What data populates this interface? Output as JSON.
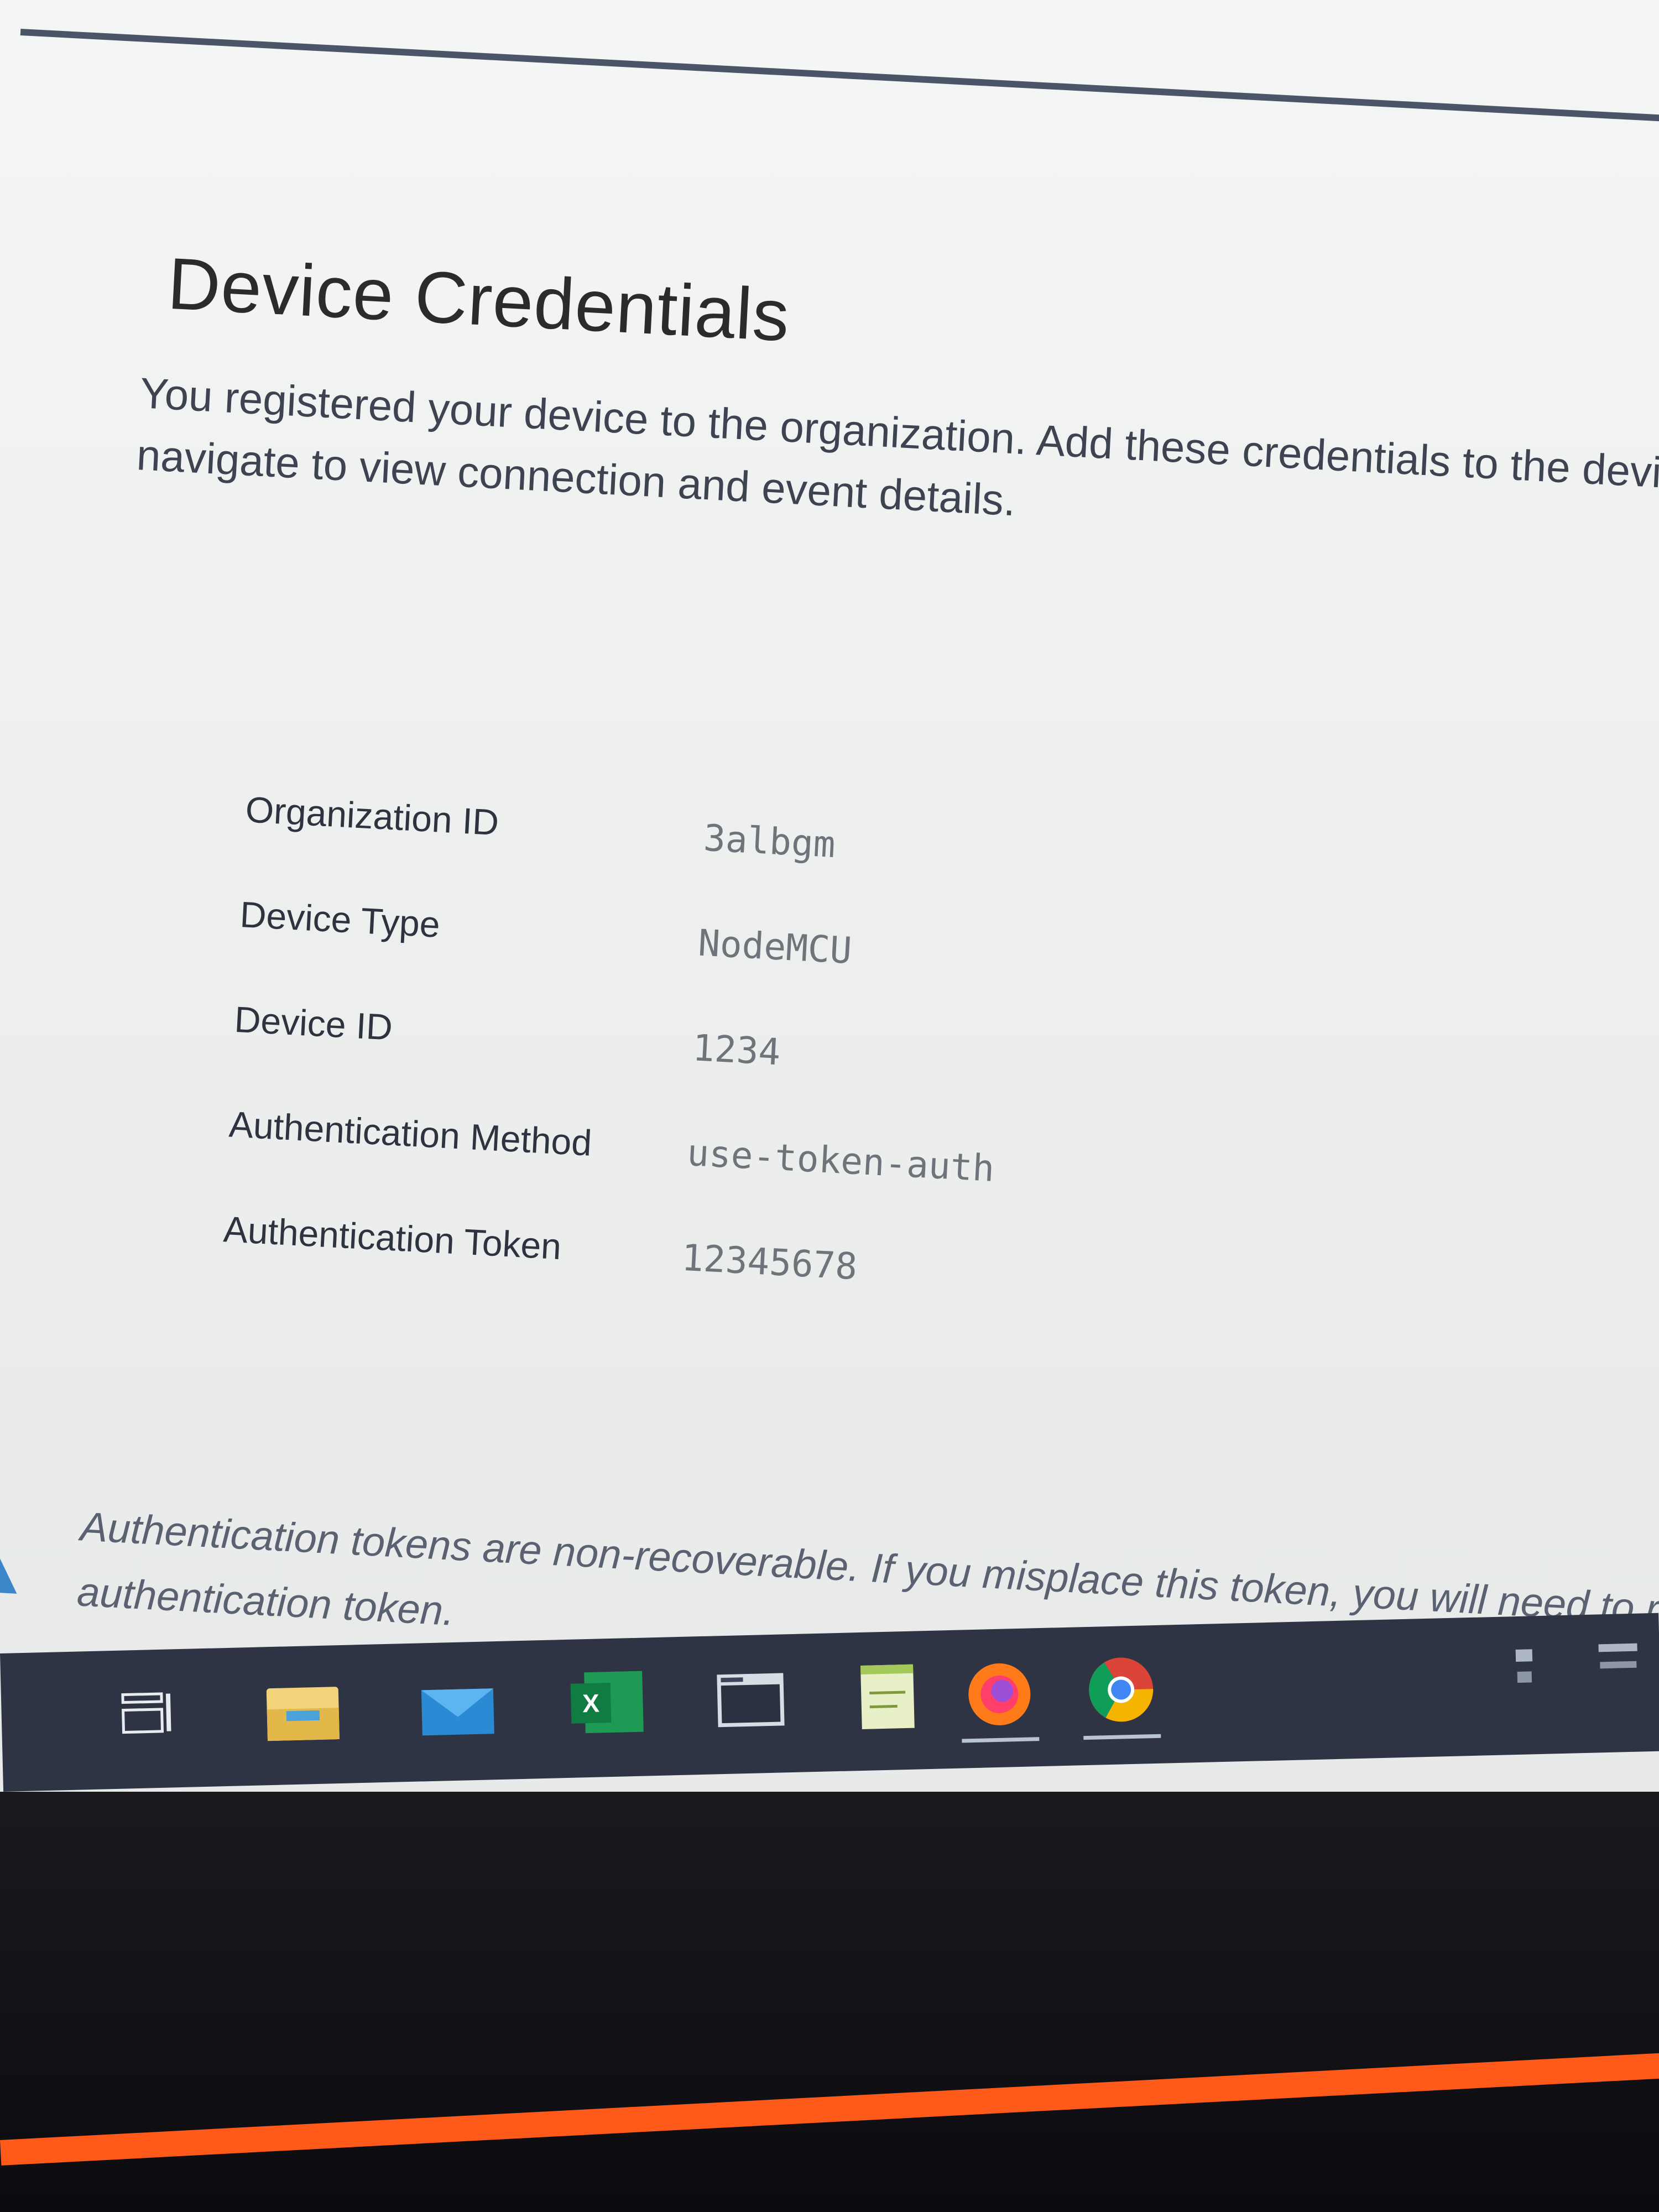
{
  "page": {
    "title": "Device Credentials",
    "description": "You registered your device to the organization. Add these credentials to the device can navigate to view connection and event details."
  },
  "credentials": [
    {
      "label": "Organization ID",
      "value": "3albgm"
    },
    {
      "label": "Device Type",
      "value": "NodeMCU"
    },
    {
      "label": "Device ID",
      "value": "1234"
    },
    {
      "label": "Authentication Method",
      "value": "use-token-auth"
    },
    {
      "label": "Authentication Token",
      "value": "12345678"
    }
  ],
  "warning": {
    "icon": "warning-triangle-icon",
    "text": "Authentication tokens are non-recoverable. If you misplace this token, you will need to re authentication token."
  },
  "taskbar": {
    "items": [
      {
        "name": "task-view-icon",
        "active": false
      },
      {
        "name": "file-explorer-icon",
        "active": false
      },
      {
        "name": "mail-icon",
        "active": false
      },
      {
        "name": "excel-icon",
        "active": false
      },
      {
        "name": "window-app-icon",
        "active": false
      },
      {
        "name": "notepad-icon",
        "active": false
      },
      {
        "name": "firefox-icon",
        "active": true
      },
      {
        "name": "chrome-icon",
        "active": true
      }
    ]
  },
  "colors": {
    "taskbar": "#2f3444",
    "warning_icon": "#3a86c8",
    "accent_edge": "#ff5a1a"
  }
}
